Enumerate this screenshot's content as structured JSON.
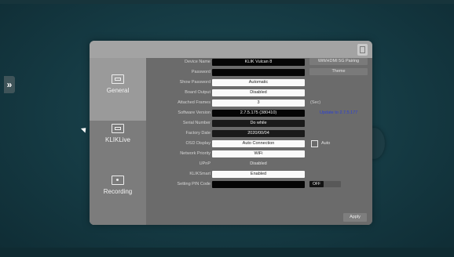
{
  "expand_icon_glyph": "»",
  "tabs": [
    {
      "label": "General",
      "icon": "settings-card-icon"
    },
    {
      "label": "KLIKLive",
      "icon": "live-card-icon"
    },
    {
      "label": "Recording",
      "icon": "recording-icon"
    }
  ],
  "fields": {
    "device_name": {
      "label": "Device Name",
      "value": "KLIK Vulcan 8"
    },
    "password": {
      "label": "Password",
      "value": ""
    },
    "show_password": {
      "label": "Show Password",
      "value": "Automatic"
    },
    "board_output": {
      "label": "Board Output",
      "value": "Disabled"
    },
    "attached_frames": {
      "label": "Attached Frames",
      "value": "3"
    },
    "software_version": {
      "label": "Software Version",
      "value": "2.7.5.175 (380410)"
    },
    "serial_number": {
      "label": "Serial Number",
      "value": "Do while"
    },
    "factory_date": {
      "label": "Factory Date",
      "value": "2020/00/04"
    },
    "osd_display": {
      "label": "OSD Display",
      "value": "Auto Connection"
    },
    "network_priority": {
      "label": "Network Priority",
      "value": "WiFi"
    },
    "upnp": {
      "label": "UPnP",
      "value": "Disabled"
    },
    "klik_smart": {
      "label": "KLIKSmart",
      "value": "Enabled"
    },
    "setting_pin_code": {
      "label": "Setting PIN Code",
      "value": ""
    }
  },
  "side_buttons": {
    "wifi_hdmi_pairing": "Wifi/HDMI 5G Pairing",
    "theme": "Theme"
  },
  "frames_note": "(Sec)",
  "update_link": "Update to 2.7.5.177",
  "auto_checkbox_label": "Auto",
  "pin_toggle_label": "OFF",
  "apply_label": "Apply"
}
